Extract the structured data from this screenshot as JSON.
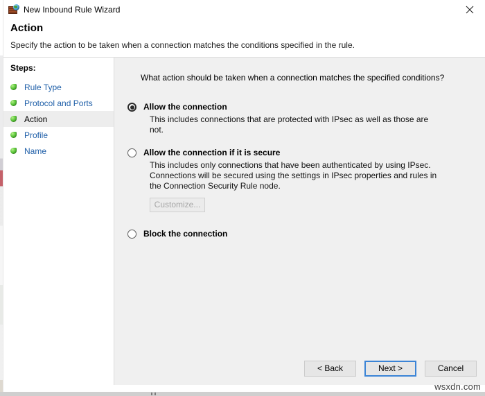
{
  "window": {
    "title": "New Inbound Rule Wizard",
    "icon": "firewall-globe-icon",
    "close_label": "close-icon"
  },
  "header": {
    "title": "Action",
    "subtitle": "Specify the action to be taken when a connection matches the conditions specified in the rule."
  },
  "sidebar": {
    "heading": "Steps:",
    "items": [
      {
        "label": "Rule Type",
        "current": false
      },
      {
        "label": "Protocol and Ports",
        "current": false
      },
      {
        "label": "Action",
        "current": true
      },
      {
        "label": "Profile",
        "current": false
      },
      {
        "label": "Name",
        "current": false
      }
    ]
  },
  "main": {
    "prompt": "What action should be taken when a connection matches the specified conditions?",
    "options": [
      {
        "label": "Allow the connection",
        "description": "This includes connections that are protected with IPsec as well as those are not.",
        "selected": true
      },
      {
        "label": "Allow the connection if it is secure",
        "description": "This includes only connections that have been authenticated by using IPsec.  Connections will be secured using the settings in IPsec properties and rules in the Connection Security Rule node.",
        "selected": false,
        "customize_label": "Customize..."
      },
      {
        "label": "Block the connection",
        "description": "",
        "selected": false
      }
    ]
  },
  "footer": {
    "back_label": "< Back",
    "next_label": "Next >",
    "cancel_label": "Cancel"
  },
  "watermark": "wsxdn.com",
  "colors": {
    "accent": "#3b84d6",
    "link": "#1f5fa8",
    "content_bg": "#f0f0f0",
    "step_bullet": "#5cc63b"
  }
}
